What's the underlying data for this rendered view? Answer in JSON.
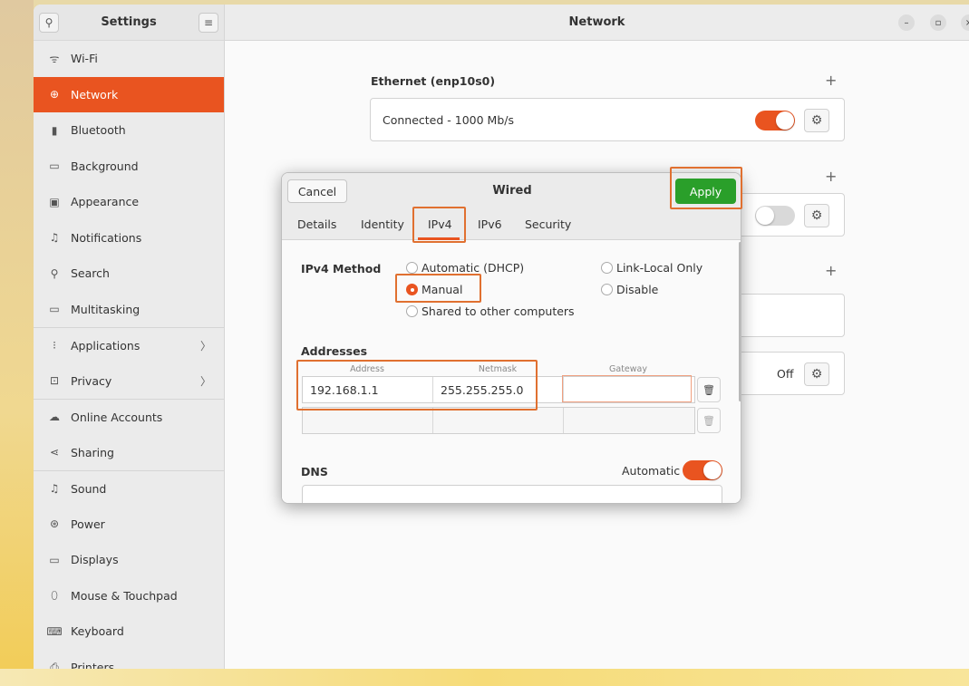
{
  "sidebar": {
    "title": "Settings",
    "items": [
      {
        "label": "Wi-Fi",
        "icon": "wifi-icon",
        "glyph": "ᯤ"
      },
      {
        "label": "Network",
        "icon": "network-icon",
        "glyph": "⊕",
        "active": true
      },
      {
        "label": "Bluetooth",
        "icon": "bluetooth-icon",
        "glyph": "▮"
      },
      {
        "label": "Background",
        "icon": "background-icon",
        "glyph": "▭"
      },
      {
        "label": "Appearance",
        "icon": "appearance-icon",
        "glyph": "▣"
      },
      {
        "label": "Notifications",
        "icon": "bell-icon",
        "glyph": "♫"
      },
      {
        "label": "Search",
        "icon": "search-icon",
        "glyph": "⚲"
      },
      {
        "label": "Multitasking",
        "icon": "multitasking-icon",
        "glyph": "▭"
      },
      {
        "label": "Applications",
        "icon": "apps-icon",
        "glyph": "⁝",
        "chevron": "〉"
      },
      {
        "label": "Privacy",
        "icon": "lock-icon",
        "glyph": "⊡",
        "chevron": "〉"
      },
      {
        "label": "Online Accounts",
        "icon": "cloud-icon",
        "glyph": "☁"
      },
      {
        "label": "Sharing",
        "icon": "share-icon",
        "glyph": "⋖"
      },
      {
        "label": "Sound",
        "icon": "music-icon",
        "glyph": "♫"
      },
      {
        "label": "Power",
        "icon": "power-icon",
        "glyph": "⊛"
      },
      {
        "label": "Displays",
        "icon": "display-icon",
        "glyph": "▭"
      },
      {
        "label": "Mouse & Touchpad",
        "icon": "mouse-icon",
        "glyph": "⬯"
      },
      {
        "label": "Keyboard",
        "icon": "keyboard-icon",
        "glyph": "⌨"
      },
      {
        "label": "Printers",
        "icon": "printer-icon",
        "glyph": "⎙"
      }
    ]
  },
  "main": {
    "title": "Network",
    "ethernet_title": "Ethernet (enp10s0)",
    "ethernet_status": "Connected - 1000 Mb/s",
    "ethernet_toggle_on": true,
    "second_toggle_on": false,
    "off_label": "Off",
    "plus": "+"
  },
  "dialog": {
    "cancel_label": "Cancel",
    "title": "Wired",
    "apply_label": "Apply",
    "tabs": [
      "Details",
      "Identity",
      "IPv4",
      "IPv6",
      "Security"
    ],
    "active_tab": "IPv4",
    "ipv4_method_label": "IPv4 Method",
    "methods": {
      "automatic": "Automatic (DHCP)",
      "manual": "Manual",
      "shared": "Shared to other computers",
      "link_local": "Link-Local Only",
      "disable": "Disable"
    },
    "selected_method": "Manual",
    "addresses_label": "Addresses",
    "columns": [
      "Address",
      "Netmask",
      "Gateway"
    ],
    "rows": [
      {
        "address": "192.168.1.1",
        "netmask": "255.255.255.0",
        "gateway": ""
      },
      {
        "address": "",
        "netmask": "",
        "gateway": ""
      }
    ],
    "dns_label": "DNS",
    "dns_automatic_label": "Automatic",
    "dns_automatic_on": true
  },
  "colors": {
    "accent": "#e95420",
    "apply_green": "#2a9f2a",
    "highlight": "#e07030"
  }
}
